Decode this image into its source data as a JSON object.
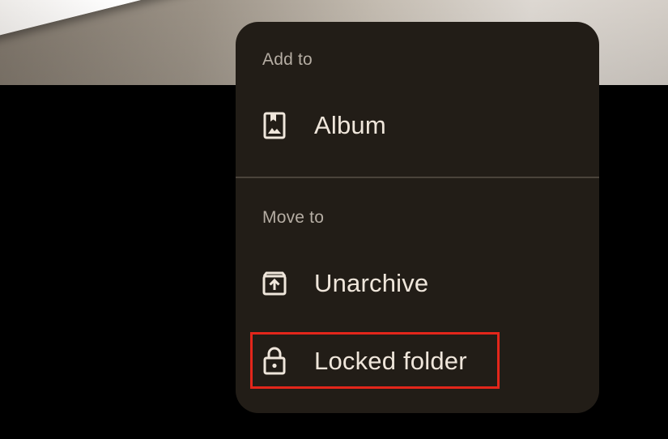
{
  "background": {
    "photo": "photo-thumbnail"
  },
  "menu": {
    "add_to_header": "Add to",
    "move_to_header": "Move to",
    "items": [
      {
        "label": "Album",
        "icon": "album-icon"
      },
      {
        "label": "Unarchive",
        "icon": "unarchive-icon"
      },
      {
        "label": "Locked folder",
        "icon": "lock-icon"
      }
    ]
  },
  "colors": {
    "menu_background": "#221d17",
    "text": "#efe6db",
    "header_text": "#b5ada3",
    "highlight": "#e3261b"
  }
}
